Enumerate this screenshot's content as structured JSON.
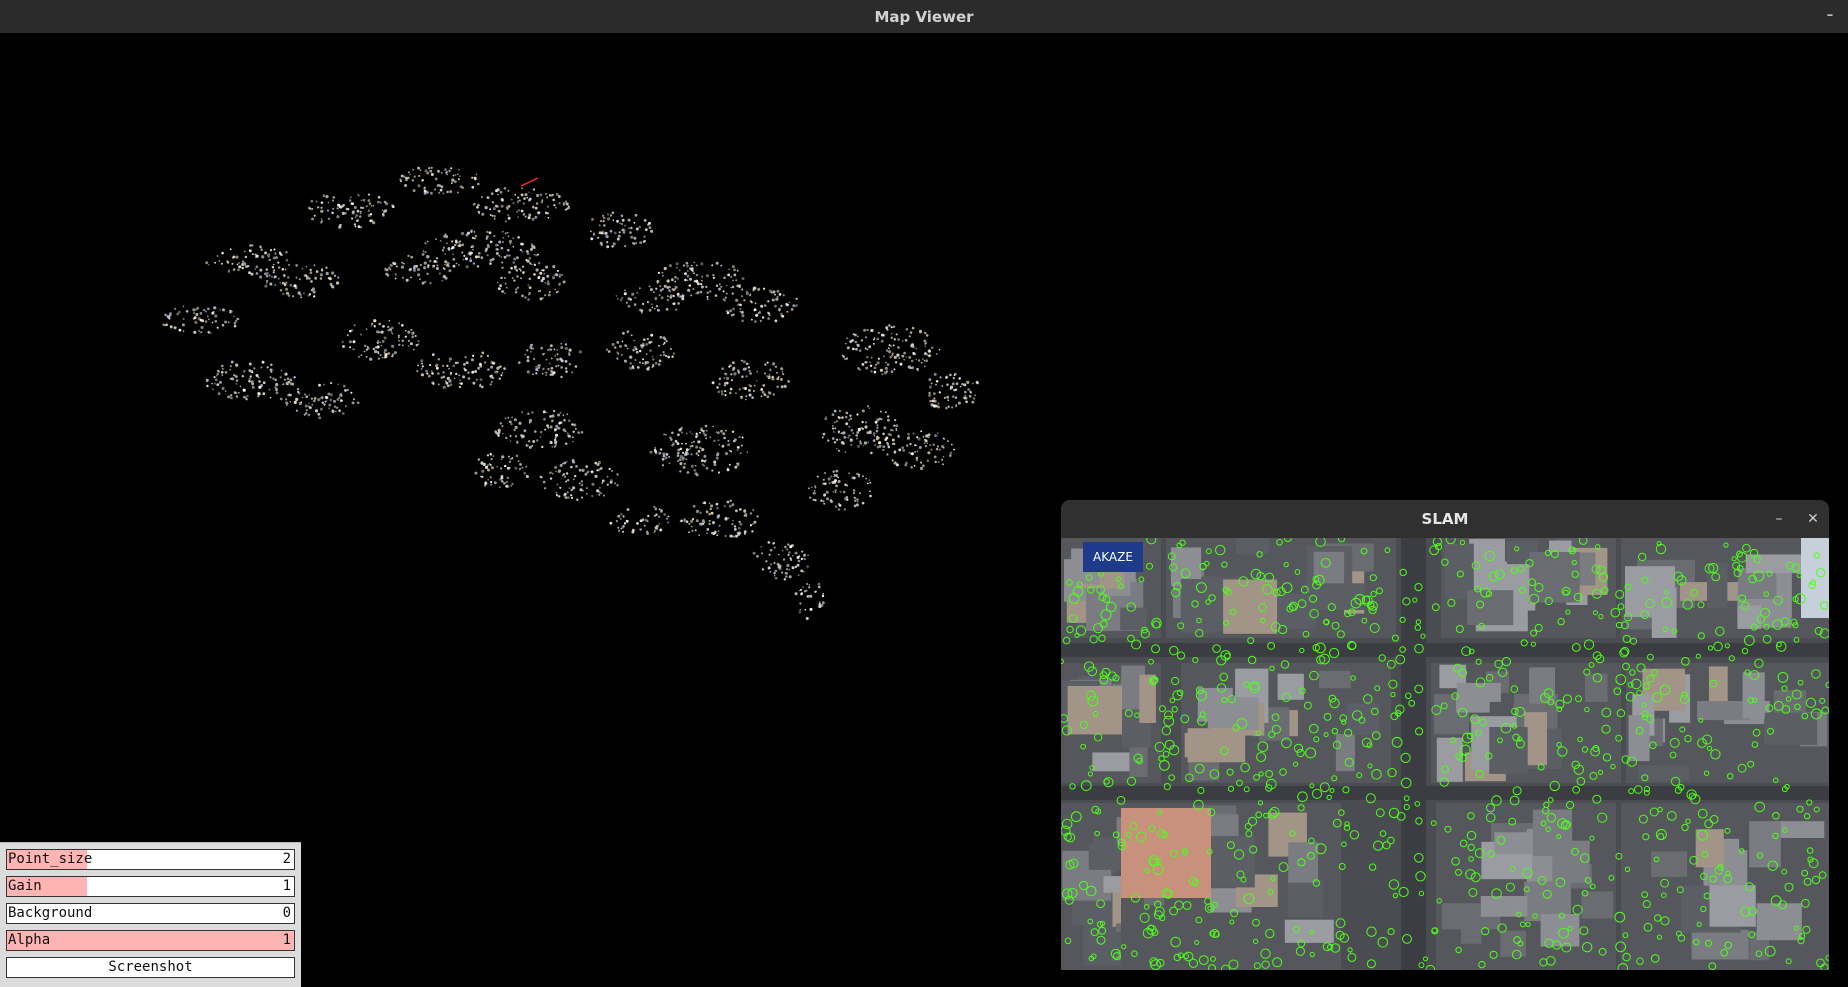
{
  "window": {
    "title": "Map Viewer"
  },
  "controls": [
    {
      "label": "Point_size",
      "value": "2",
      "fill_fraction": 0.28
    },
    {
      "label": "Gain",
      "value": "1",
      "fill_fraction": 0.28
    },
    {
      "label": "Background",
      "value": "0",
      "fill_fraction": 0.0
    },
    {
      "label": "Alpha",
      "value": "1",
      "fill_fraction": 1.0
    }
  ],
  "screenshot_button": {
    "label": "Screenshot"
  },
  "slam": {
    "title": "SLAM",
    "detector": "AKAZE",
    "minimize_icon": "minimize-icon",
    "close_icon": "close-icon"
  },
  "colors": {
    "title_bar": "#2b2b2b",
    "slider_fill": "#ffb4b4",
    "feature_marker": "#4dff1a",
    "trajectory": "#ff2a2a",
    "badge": "#1e3a8a"
  }
}
